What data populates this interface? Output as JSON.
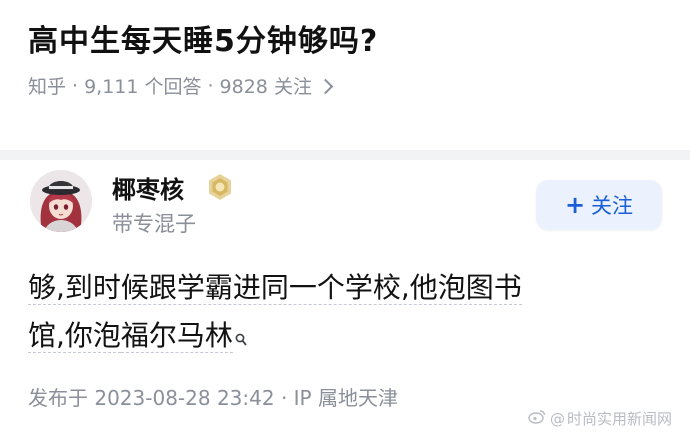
{
  "question": {
    "title": "高中生每天睡5分钟够吗?",
    "source": "知乎",
    "answers_count": "9,111 个回答",
    "followers_count": "9828 关注",
    "sep": "·"
  },
  "answer": {
    "author_name": "椰枣核",
    "author_bio": "带专混子",
    "follow_label": "关注",
    "follow_plus": "+",
    "text_line1": "够,到时候跟学霸进同一个学校,他泡图书",
    "text_line2_plain": "馆,你泡",
    "text_line2_link": "福尔马林",
    "posted": "发布于 2023-08-28 23:42 · IP 属地天津"
  },
  "watermark": {
    "at": "@",
    "text": "时尚实用新闻网"
  },
  "colors": {
    "accent": "#1a5fd6",
    "follow_bg": "#ebf2fd",
    "muted_text": "#8a8f99",
    "divider": "#f2f3f5"
  },
  "icons": {
    "badge": "gold-badge-icon",
    "chevron": "chevron-right-icon",
    "search": "search-mini-icon",
    "weibo": "weibo-logo-icon"
  }
}
